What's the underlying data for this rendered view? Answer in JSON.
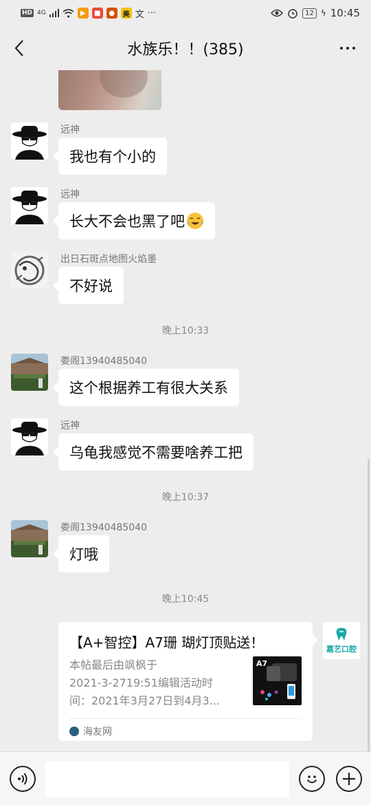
{
  "status_bar": {
    "hd": "HD",
    "signal": "4G",
    "battery": "12",
    "time": "10:45",
    "apps": [
      "video-app-icon",
      "reader-app-icon",
      "shopping-app-icon",
      "meituan-app-icon",
      "news-app-icon"
    ],
    "app_labels": [
      "",
      "",
      "",
      "美",
      "文"
    ],
    "more": "···"
  },
  "header": {
    "title": "水族乐！！(385)"
  },
  "messages": [
    {
      "sender": "远神",
      "text": "我也有个小的"
    },
    {
      "sender": "远神",
      "text": "长大不会也黑了吧"
    },
    {
      "sender": "出日石斑点地图火焰墨",
      "text": "不好说"
    },
    {
      "sender": "娄阁13940485040",
      "text": "这个根据养工有很大关系"
    },
    {
      "sender": "远神",
      "text": "乌龟我感觉不需要啥养工把"
    },
    {
      "sender": "娄阁13940485040",
      "text": "灯哦"
    }
  ],
  "timestamps": [
    "晚上10:33",
    "晚上10:37",
    "晚上10:45"
  ],
  "link_card": {
    "title": "【A+智控】A7珊 瑚灯顶贴送！",
    "desc_lines": [
      "本帖最后由飒枫于",
      "2021-3-2719:51编辑活动时",
      "间：2021年3月27日到4月3..."
    ],
    "thumb_label": "A7",
    "source": "海友网"
  },
  "my_avatar": {
    "text": "嘉艺口腔"
  },
  "colors": {
    "background": "#ededed",
    "bubble": "#ffffff",
    "accent": "#1aa9a9"
  }
}
